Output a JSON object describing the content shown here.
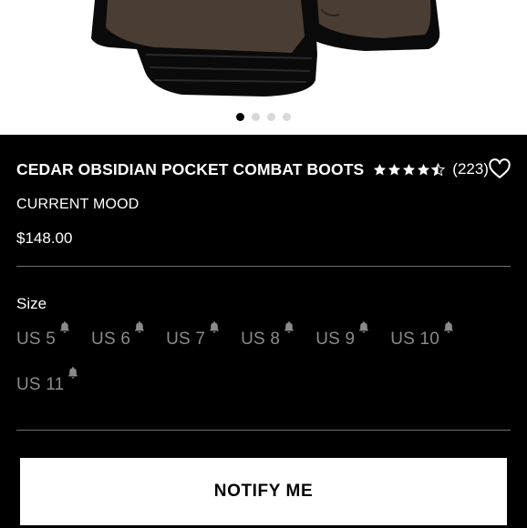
{
  "product": {
    "title": "CEDAR OBSIDIAN POCKET COMBAT BOOTS",
    "rating": 4.5,
    "review_count": "(223)",
    "brand": "CURRENT MOOD",
    "price": "$148.00"
  },
  "carousel": {
    "slides": 4,
    "active_index": 0
  },
  "size_section": {
    "label": "Size",
    "options": [
      "US 5",
      "US 6",
      "US 7",
      "US 8",
      "US 9",
      "US 10",
      "US 11"
    ]
  },
  "cta": {
    "label": "NOTIFY ME"
  },
  "icons": {
    "star": "star-icon",
    "wishlist": "heart-outline-icon",
    "size_alert": "bell-icon"
  },
  "colors": {
    "background": "#000000",
    "text": "#ffffff",
    "unavailable_size": "#8a8a8a",
    "button_bg": "#ffffff",
    "button_text": "#000000",
    "boot_upper": "#4a3d33"
  }
}
